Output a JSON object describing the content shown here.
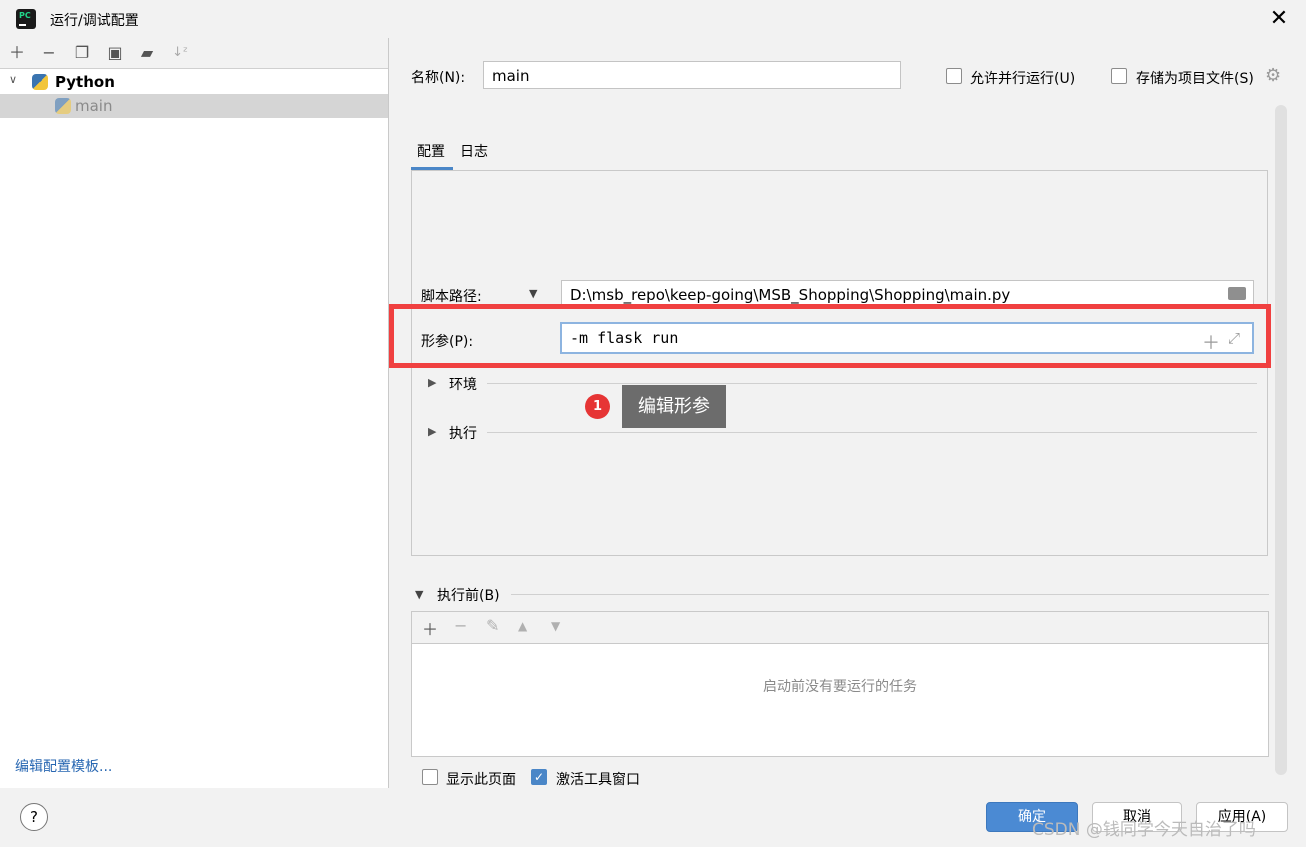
{
  "window": {
    "title": "运行/调试配置",
    "close_symbol": "✕",
    "app_icon_text": "PC"
  },
  "left_toolbar": [
    "add-icon",
    "remove-icon",
    "copy-icon",
    "save-icon",
    "folder-add-icon",
    "sort-icon"
  ],
  "tree": {
    "group": "Python",
    "item": "main"
  },
  "left_footer": {
    "edit_template": "编辑配置模板..."
  },
  "form": {
    "name_label": "名称(N):",
    "name_value": "main",
    "allow_parallel": {
      "label": "允许并行运行(U)",
      "checked": false
    },
    "store_as_project_file": {
      "label": "存储为项目文件(S)",
      "checked": false
    }
  },
  "tabs": [
    {
      "label": "配置",
      "active": true
    },
    {
      "label": "日志",
      "active": false
    }
  ],
  "config": {
    "script_path_label": "脚本路径:",
    "script_path_value": "D:\\msb_repo\\keep-going\\MSB_Shopping\\Shopping\\main.py",
    "params_label": "形参(P):",
    "params_value": "-m flask run",
    "env_label": "环境",
    "exec_label": "执行"
  },
  "annotation": {
    "badge": "1",
    "tooltip": "编辑形参",
    "highlight_color": "#f04040"
  },
  "before_launch": {
    "label": "执行前(B)",
    "empty_text": "启动前没有要运行的任务"
  },
  "bottom_options": {
    "show_page": {
      "label": "显示此页面",
      "checked": false
    },
    "activate_tool_window": {
      "label": "激活工具窗口",
      "checked": true
    }
  },
  "footer": {
    "help": "?",
    "ok": "确定",
    "cancel": "取消",
    "apply": "应用(A)"
  },
  "watermark": "CSDN @钱同学今天自治了吗",
  "colors": {
    "accent": "#4a86c7",
    "primary_button": "#4b8ad3",
    "highlight": "#f04040"
  }
}
